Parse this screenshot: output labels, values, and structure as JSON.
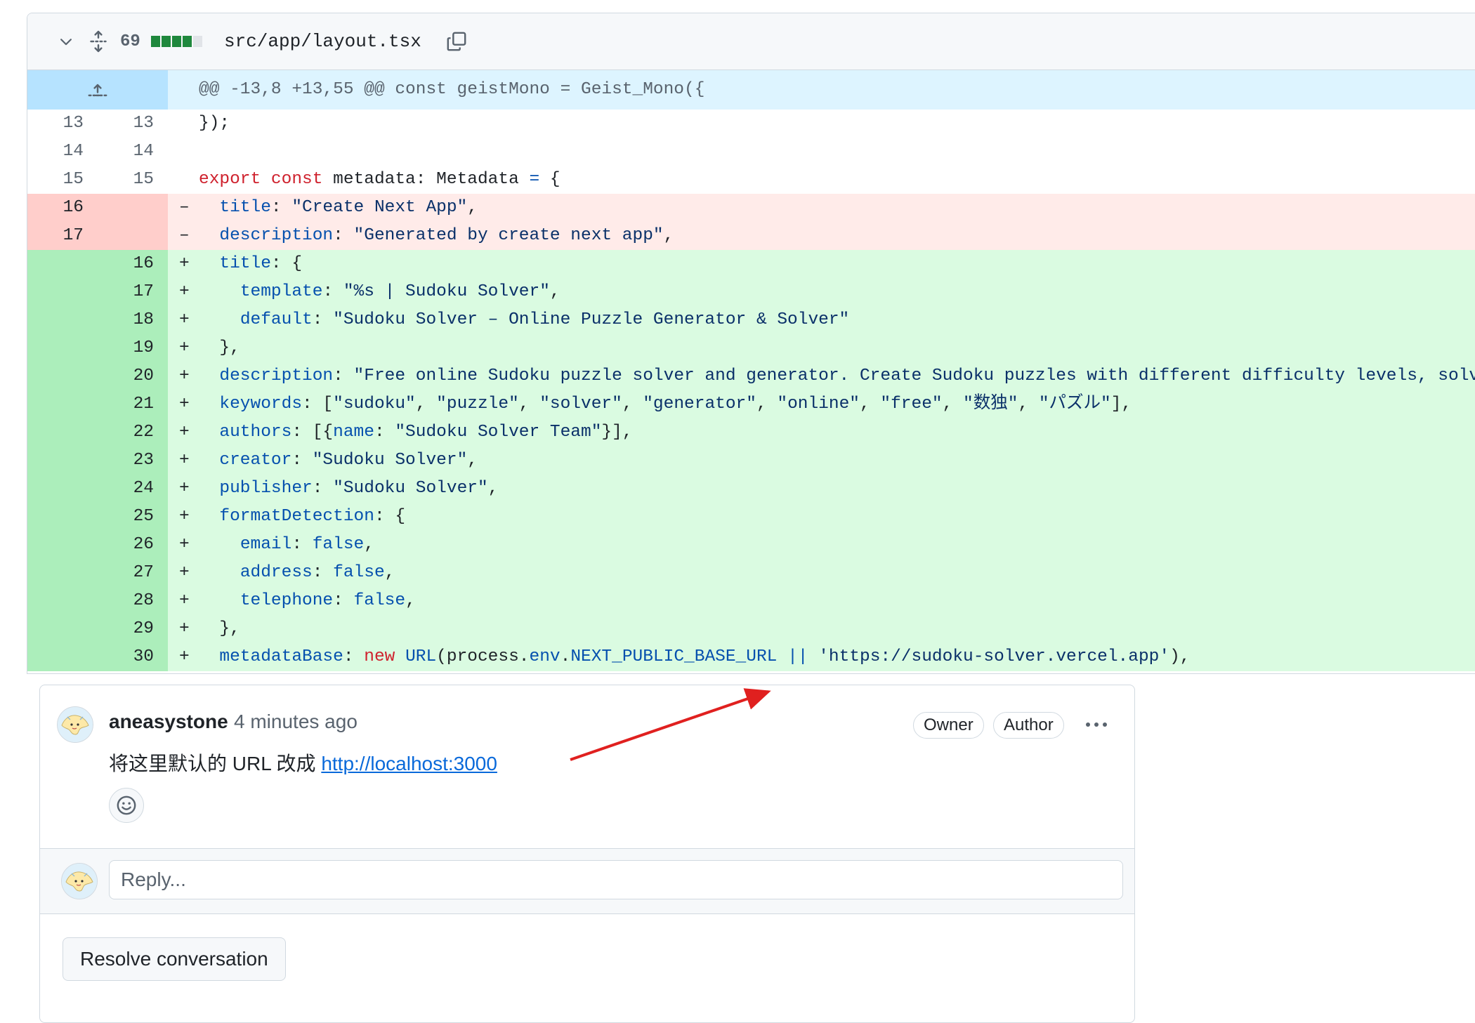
{
  "file": {
    "change_count": "69",
    "diffstat": [
      "add",
      "add",
      "add",
      "add",
      "neutral"
    ],
    "path": "src/app/layout.tsx",
    "hunk_header": "@@ -13,8 +13,55 @@ const geistMono = Geist_Mono({"
  },
  "diff_lines": [
    {
      "type": "ctx",
      "old": "13",
      "new": "13",
      "marker": "",
      "tokens": [
        [
          "p",
          "});"
        ]
      ]
    },
    {
      "type": "ctx",
      "old": "14",
      "new": "14",
      "marker": "",
      "tokens": []
    },
    {
      "type": "ctx",
      "old": "15",
      "new": "15",
      "marker": "",
      "tokens": [
        [
          "kw",
          "export"
        ],
        [
          "p",
          " "
        ],
        [
          "kw",
          "const"
        ],
        [
          "p",
          " metadata: Metadata "
        ],
        [
          "id",
          "="
        ],
        [
          "p",
          " {"
        ]
      ]
    },
    {
      "type": "del",
      "old": "16",
      "new": "",
      "marker": "–",
      "tokens": [
        [
          "p",
          "  "
        ],
        [
          "id",
          "title"
        ],
        [
          "p",
          ": "
        ],
        [
          "str",
          "\"Create Next App\""
        ],
        [
          "p",
          ","
        ]
      ]
    },
    {
      "type": "del",
      "old": "17",
      "new": "",
      "marker": "–",
      "tokens": [
        [
          "p",
          "  "
        ],
        [
          "id",
          "description"
        ],
        [
          "p",
          ": "
        ],
        [
          "str",
          "\"Generated by create next app\""
        ],
        [
          "p",
          ","
        ]
      ]
    },
    {
      "type": "add",
      "old": "",
      "new": "16",
      "marker": "+",
      "tokens": [
        [
          "p",
          "  "
        ],
        [
          "id",
          "title"
        ],
        [
          "p",
          ": {"
        ]
      ]
    },
    {
      "type": "add",
      "old": "",
      "new": "17",
      "marker": "+",
      "tokens": [
        [
          "p",
          "    "
        ],
        [
          "id",
          "template"
        ],
        [
          "p",
          ": "
        ],
        [
          "str",
          "\"%s | Sudoku Solver\""
        ],
        [
          "p",
          ","
        ]
      ]
    },
    {
      "type": "add",
      "old": "",
      "new": "18",
      "marker": "+",
      "tokens": [
        [
          "p",
          "    "
        ],
        [
          "id",
          "default"
        ],
        [
          "p",
          ": "
        ],
        [
          "str",
          "\"Sudoku Solver – Online Puzzle Generator & Solver\""
        ]
      ]
    },
    {
      "type": "add",
      "old": "",
      "new": "19",
      "marker": "+",
      "tokens": [
        [
          "p",
          "  },"
        ]
      ]
    },
    {
      "type": "add",
      "old": "",
      "new": "20",
      "marker": "+",
      "tokens": [
        [
          "p",
          "  "
        ],
        [
          "id",
          "description"
        ],
        [
          "p",
          ": "
        ],
        [
          "str",
          "\"Free online Sudoku puzzle solver and generator. Create Sudoku puzzles with different difficulty levels, solve"
        ]
      ]
    },
    {
      "type": "add",
      "old": "",
      "new": "21",
      "marker": "+",
      "tokens": [
        [
          "p",
          "  "
        ],
        [
          "id",
          "keywords"
        ],
        [
          "p",
          ": ["
        ],
        [
          "str",
          "\"sudoku\""
        ],
        [
          "p",
          ", "
        ],
        [
          "str",
          "\"puzzle\""
        ],
        [
          "p",
          ", "
        ],
        [
          "str",
          "\"solver\""
        ],
        [
          "p",
          ", "
        ],
        [
          "str",
          "\"generator\""
        ],
        [
          "p",
          ", "
        ],
        [
          "str",
          "\"online\""
        ],
        [
          "p",
          ", "
        ],
        [
          "str",
          "\"free\""
        ],
        [
          "p",
          ", "
        ],
        [
          "str",
          "\"数独\""
        ],
        [
          "p",
          ", "
        ],
        [
          "str",
          "\"パズル\""
        ],
        [
          "p",
          "],"
        ]
      ]
    },
    {
      "type": "add",
      "old": "",
      "new": "22",
      "marker": "+",
      "tokens": [
        [
          "p",
          "  "
        ],
        [
          "id",
          "authors"
        ],
        [
          "p",
          ": [{"
        ],
        [
          "id",
          "name"
        ],
        [
          "p",
          ": "
        ],
        [
          "str",
          "\"Sudoku Solver Team\""
        ],
        [
          "p",
          "}],"
        ]
      ]
    },
    {
      "type": "add",
      "old": "",
      "new": "23",
      "marker": "+",
      "tokens": [
        [
          "p",
          "  "
        ],
        [
          "id",
          "creator"
        ],
        [
          "p",
          ": "
        ],
        [
          "str",
          "\"Sudoku Solver\""
        ],
        [
          "p",
          ","
        ]
      ]
    },
    {
      "type": "add",
      "old": "",
      "new": "24",
      "marker": "+",
      "tokens": [
        [
          "p",
          "  "
        ],
        [
          "id",
          "publisher"
        ],
        [
          "p",
          ": "
        ],
        [
          "str",
          "\"Sudoku Solver\""
        ],
        [
          "p",
          ","
        ]
      ]
    },
    {
      "type": "add",
      "old": "",
      "new": "25",
      "marker": "+",
      "tokens": [
        [
          "p",
          "  "
        ],
        [
          "id",
          "formatDetection"
        ],
        [
          "p",
          ": {"
        ]
      ]
    },
    {
      "type": "add",
      "old": "",
      "new": "26",
      "marker": "+",
      "tokens": [
        [
          "p",
          "    "
        ],
        [
          "id",
          "email"
        ],
        [
          "p",
          ": "
        ],
        [
          "id",
          "false"
        ],
        [
          "p",
          ","
        ]
      ]
    },
    {
      "type": "add",
      "old": "",
      "new": "27",
      "marker": "+",
      "tokens": [
        [
          "p",
          "    "
        ],
        [
          "id",
          "address"
        ],
        [
          "p",
          ": "
        ],
        [
          "id",
          "false"
        ],
        [
          "p",
          ","
        ]
      ]
    },
    {
      "type": "add",
      "old": "",
      "new": "28",
      "marker": "+",
      "tokens": [
        [
          "p",
          "    "
        ],
        [
          "id",
          "telephone"
        ],
        [
          "p",
          ": "
        ],
        [
          "id",
          "false"
        ],
        [
          "p",
          ","
        ]
      ]
    },
    {
      "type": "add",
      "old": "",
      "new": "29",
      "marker": "+",
      "tokens": [
        [
          "p",
          "  },"
        ]
      ]
    },
    {
      "type": "add",
      "old": "",
      "new": "30",
      "marker": "+",
      "tokens": [
        [
          "p",
          "  "
        ],
        [
          "id",
          "metadataBase"
        ],
        [
          "p",
          ": "
        ],
        [
          "kw",
          "new"
        ],
        [
          "p",
          " "
        ],
        [
          "id",
          "URL"
        ],
        [
          "p",
          "(process."
        ],
        [
          "id",
          "env"
        ],
        [
          "p",
          "."
        ],
        [
          "id",
          "NEXT_PUBLIC_BASE_URL"
        ],
        [
          "p",
          " "
        ],
        [
          "id",
          "||"
        ],
        [
          "p",
          " "
        ],
        [
          "str",
          "'https://sudoku-solver.vercel.app'"
        ],
        [
          "p",
          "),"
        ]
      ]
    }
  ],
  "comment": {
    "author": "aneasystone",
    "time": "4 minutes ago",
    "badges": {
      "owner": "Owner",
      "author": "Author"
    },
    "body_text": "将这里默认的 URL 改成 ",
    "body_link": "http://localhost:3000"
  },
  "reply": {
    "placeholder": "Reply..."
  },
  "resolve_label": "Resolve conversation",
  "colors": {
    "accent": "#0969da",
    "addition_bg": "#dafbe1",
    "deletion_bg": "#ffebe9",
    "hunk_bg": "#ddf4ff",
    "annotation_arrow": "#e0201f"
  },
  "icons": {
    "collapse": "chevron-down-icon",
    "expand_all": "unfold-icon",
    "copy": "copy-icon",
    "expand_up": "expand-up-icon",
    "more": "kebab-horizontal-icon",
    "reaction": "smiley-icon"
  }
}
